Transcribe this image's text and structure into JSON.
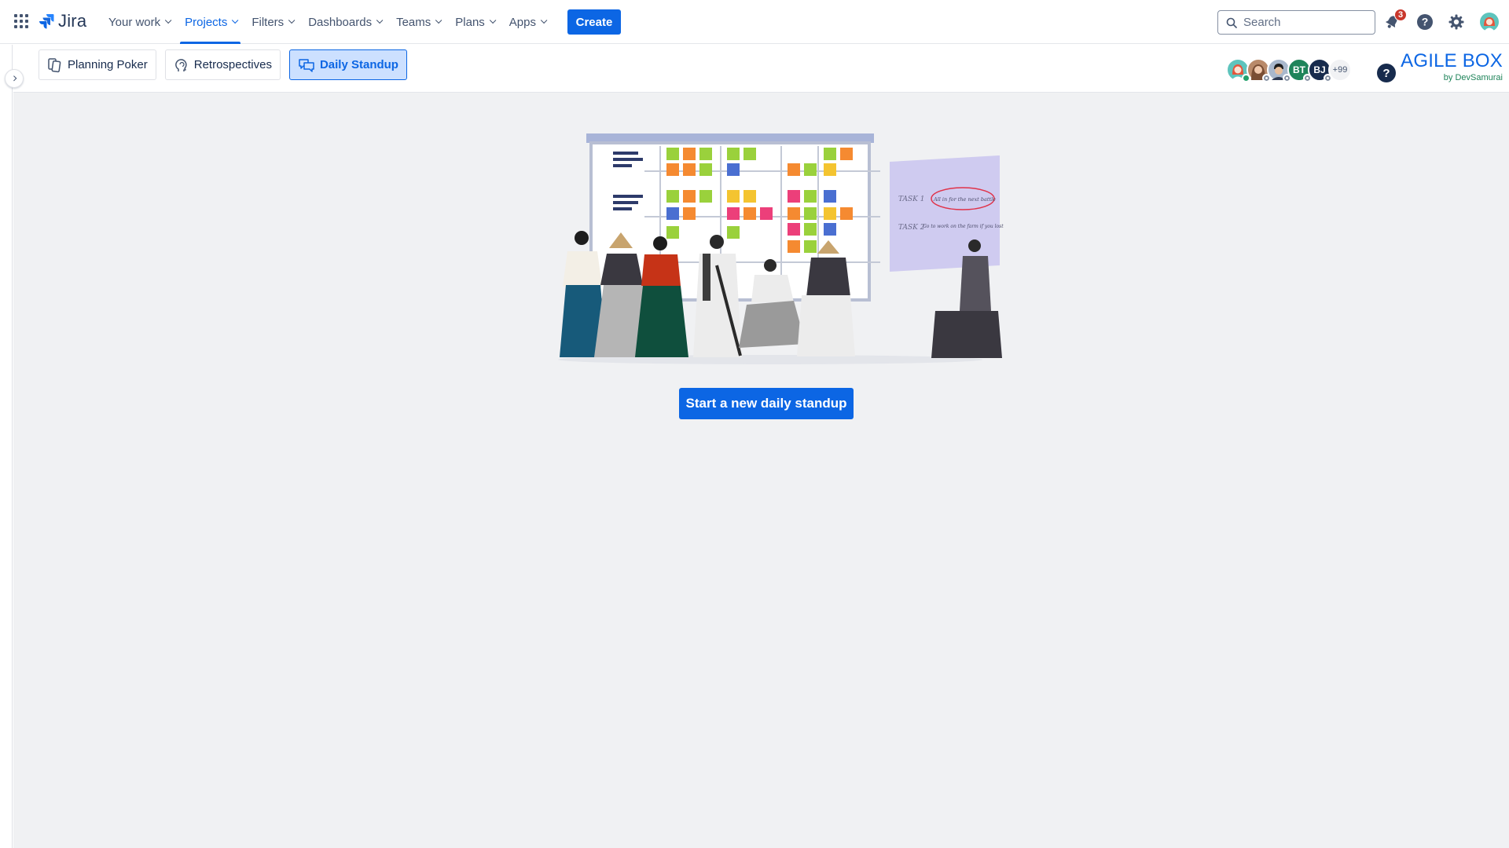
{
  "topbar": {
    "app_name": "Jira",
    "nav": [
      {
        "label": "Your work",
        "active": false
      },
      {
        "label": "Projects",
        "active": true
      },
      {
        "label": "Filters",
        "active": false
      },
      {
        "label": "Dashboards",
        "active": false
      },
      {
        "label": "Teams",
        "active": false
      },
      {
        "label": "Plans",
        "active": false
      },
      {
        "label": "Apps",
        "active": false
      }
    ],
    "create_label": "Create",
    "search_placeholder": "Search",
    "notification_count": "3",
    "icons": [
      "app-switcher-icon",
      "notification-bell-icon",
      "help-icon",
      "settings-gear-icon",
      "user-avatar"
    ]
  },
  "app_header": {
    "tabs": [
      {
        "label": "Planning Poker",
        "icon": "cards-icon",
        "active": false
      },
      {
        "label": "Retrospectives",
        "icon": "head-icon",
        "active": false
      },
      {
        "label": "Daily Standup",
        "icon": "chat-bubbles-icon",
        "active": true
      }
    ],
    "participants": [
      {
        "initials": "",
        "color": "#5ec4bd",
        "status": "online"
      },
      {
        "initials": "",
        "color": "#b98a6a",
        "status": "away"
      },
      {
        "initials": "",
        "color": "#7a8ca8",
        "status": "away"
      },
      {
        "initials": "BT",
        "color": "#1f845a",
        "status": "away"
      },
      {
        "initials": "BJ",
        "color": "#172b4d",
        "status": "away"
      }
    ],
    "more_count": "+99",
    "help_label": "?",
    "brand_title": "AGILE BOX",
    "brand_subtitle": "by DevSamurai"
  },
  "main": {
    "illustration": "samurai-team-standup-board",
    "board_notes": {
      "task1_label": "TASK 1",
      "task1_text": "All in for the next battle",
      "task2_label": "TASK 2",
      "task2_text": "Go to work on the farm if you lost"
    },
    "start_button_label": "Start a new daily standup"
  },
  "colors": {
    "accent": "#0c66e4",
    "background": "#f0f1f3",
    "badge": "#c9372c",
    "brand_sub": "#1f845a"
  }
}
